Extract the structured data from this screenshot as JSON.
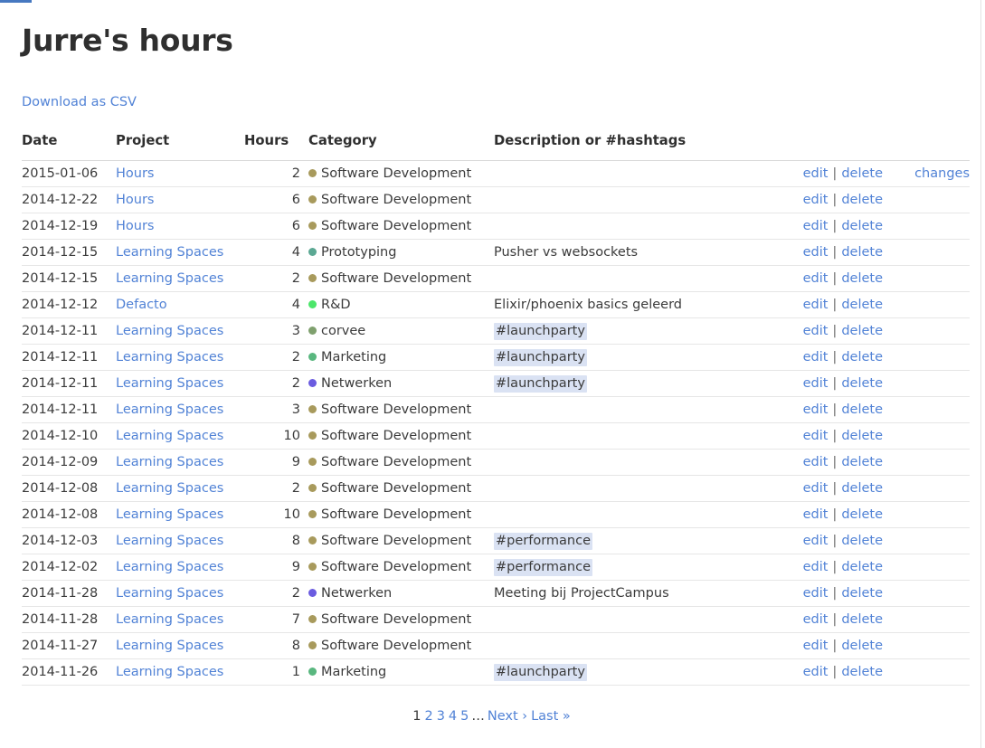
{
  "page": {
    "title": "Jurre's hours",
    "csv_link": "Download as CSV",
    "progress_color": "#4678c0",
    "link_color": "#5283d6",
    "hashtag_bg": "#dae2f3"
  },
  "table": {
    "headers": {
      "date": "Date",
      "project": "Project",
      "hours": "Hours",
      "category": "Category",
      "description": "Description or #hashtags"
    },
    "actions": {
      "edit": "edit",
      "separator": "|",
      "delete": "delete",
      "changes": "changes"
    },
    "category_colors": {
      "Software Development": "#a89a5c",
      "Prototyping": "#5ba893",
      "R&D": "#4ce66a",
      "corvee": "#7fa06e",
      "Marketing": "#59b77f",
      "Netwerken": "#6b5ce0"
    },
    "rows": [
      {
        "date": "2015-01-06",
        "project": "Hours",
        "hours": "2",
        "category": "Software Development",
        "desc": "",
        "hashtag": "",
        "changes": true
      },
      {
        "date": "2014-12-22",
        "project": "Hours",
        "hours": "6",
        "category": "Software Development",
        "desc": "",
        "hashtag": "",
        "changes": false
      },
      {
        "date": "2014-12-19",
        "project": "Hours",
        "hours": "6",
        "category": "Software Development",
        "desc": "",
        "hashtag": "",
        "changes": false
      },
      {
        "date": "2014-12-15",
        "project": "Learning Spaces",
        "hours": "4",
        "category": "Prototyping",
        "desc": "Pusher vs websockets",
        "hashtag": "",
        "changes": false
      },
      {
        "date": "2014-12-15",
        "project": "Learning Spaces",
        "hours": "2",
        "category": "Software Development",
        "desc": "",
        "hashtag": "",
        "changes": false
      },
      {
        "date": "2014-12-12",
        "project": "Defacto",
        "hours": "4",
        "category": "R&D",
        "desc": "Elixir/phoenix basics geleerd",
        "hashtag": "",
        "changes": false
      },
      {
        "date": "2014-12-11",
        "project": "Learning Spaces",
        "hours": "3",
        "category": "corvee",
        "desc": "",
        "hashtag": "#launchparty",
        "changes": false
      },
      {
        "date": "2014-12-11",
        "project": "Learning Spaces",
        "hours": "2",
        "category": "Marketing",
        "desc": "",
        "hashtag": "#launchparty",
        "changes": false
      },
      {
        "date": "2014-12-11",
        "project": "Learning Spaces",
        "hours": "2",
        "category": "Netwerken",
        "desc": "",
        "hashtag": "#launchparty",
        "changes": false
      },
      {
        "date": "2014-12-11",
        "project": "Learning Spaces",
        "hours": "3",
        "category": "Software Development",
        "desc": "",
        "hashtag": "",
        "changes": false
      },
      {
        "date": "2014-12-10",
        "project": "Learning Spaces",
        "hours": "10",
        "category": "Software Development",
        "desc": "",
        "hashtag": "",
        "changes": false
      },
      {
        "date": "2014-12-09",
        "project": "Learning Spaces",
        "hours": "9",
        "category": "Software Development",
        "desc": "",
        "hashtag": "",
        "changes": false
      },
      {
        "date": "2014-12-08",
        "project": "Learning Spaces",
        "hours": "2",
        "category": "Software Development",
        "desc": "",
        "hashtag": "",
        "changes": false
      },
      {
        "date": "2014-12-08",
        "project": "Learning Spaces",
        "hours": "10",
        "category": "Software Development",
        "desc": "",
        "hashtag": "",
        "changes": false
      },
      {
        "date": "2014-12-03",
        "project": "Learning Spaces",
        "hours": "8",
        "category": "Software Development",
        "desc": "",
        "hashtag": "#performance",
        "changes": false
      },
      {
        "date": "2014-12-02",
        "project": "Learning Spaces",
        "hours": "9",
        "category": "Software Development",
        "desc": "",
        "hashtag": "#performance",
        "changes": false
      },
      {
        "date": "2014-11-28",
        "project": "Learning Spaces",
        "hours": "2",
        "category": "Netwerken",
        "desc": "Meeting bij ProjectCampus",
        "hashtag": "",
        "changes": false
      },
      {
        "date": "2014-11-28",
        "project": "Learning Spaces",
        "hours": "7",
        "category": "Software Development",
        "desc": "",
        "hashtag": "",
        "changes": false
      },
      {
        "date": "2014-11-27",
        "project": "Learning Spaces",
        "hours": "8",
        "category": "Software Development",
        "desc": "",
        "hashtag": "",
        "changes": false
      },
      {
        "date": "2014-11-26",
        "project": "Learning Spaces",
        "hours": "1",
        "category": "Marketing",
        "desc": "",
        "hashtag": "#launchparty",
        "changes": false
      }
    ]
  },
  "pagination": {
    "current": "1",
    "pages": [
      "2",
      "3",
      "4",
      "5"
    ],
    "gap": "…",
    "next": "Next ›",
    "last": "Last »"
  }
}
